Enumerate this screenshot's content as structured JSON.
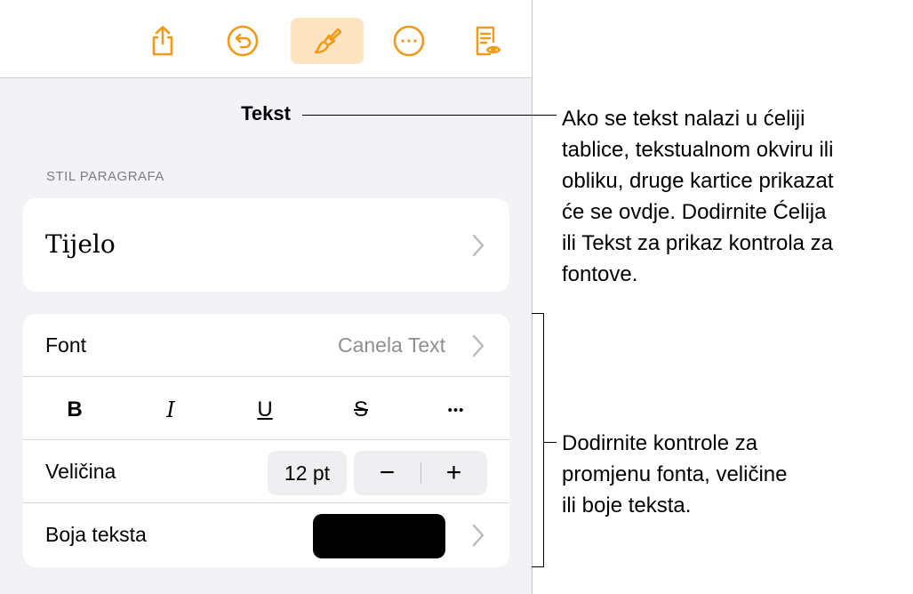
{
  "toolbar": {
    "icons": [
      "share-icon",
      "undo-icon",
      "paintbrush-icon",
      "more-icon",
      "reader-view-icon"
    ],
    "accent": "#f09a1a"
  },
  "panel": {
    "title": "Tekst",
    "section_label": "STIL PARAGRAFA",
    "paragraph_style": "Tijelo",
    "font": {
      "label": "Font",
      "value": "Canela Text"
    },
    "format_buttons": {
      "bold": "B",
      "italic": "I",
      "underline": "U",
      "strike": "S",
      "more": "•••"
    },
    "size": {
      "label": "Veličina",
      "value": "12 pt",
      "minus": "−",
      "plus": "+"
    },
    "text_color": {
      "label": "Boja teksta",
      "color": "#000000"
    }
  },
  "callouts": {
    "tabs_note": [
      "Ako se tekst nalazi u ćeliji",
      "tablice, tekstualnom okviru ili",
      "obliku, druge kartice prikazat",
      "će se ovdje. Dodirnite Ćelija",
      "ili Tekst za prikaz kontrola za",
      "fontove."
    ],
    "controls_note": [
      "Dodirnite kontrole za",
      "promjenu fonta, veličine",
      "ili boje teksta."
    ]
  }
}
